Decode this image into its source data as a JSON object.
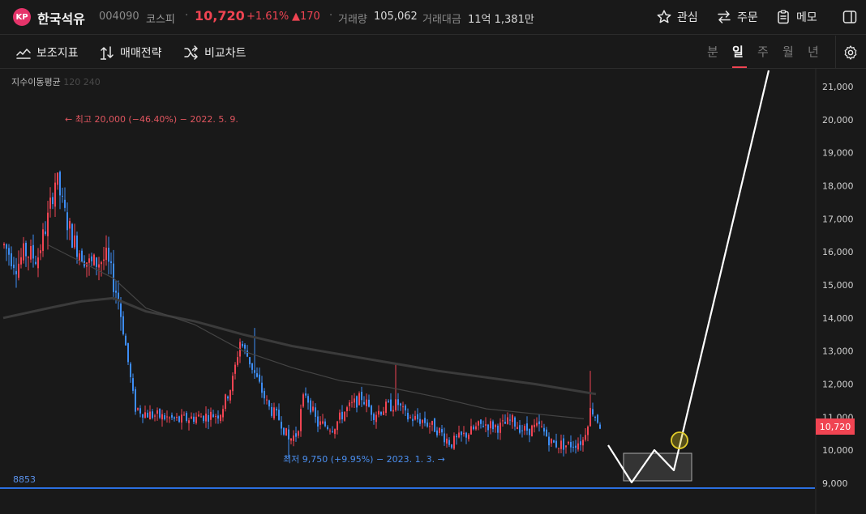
{
  "header": {
    "logo_text": "KP",
    "name": "한국석유",
    "code": "004090",
    "market": "코스피",
    "price": "10,720",
    "change_pct": "+1.61%",
    "change_amt": "▲170",
    "volume_label": "거래량",
    "volume_value": "105,062",
    "amount_label": "거래대금",
    "amount_value": "11억 1,381만",
    "favorite_label": "관심",
    "order_label": "주문",
    "memo_label": "메모"
  },
  "toolbar": {
    "indicator_label": "보조지표",
    "strategy_label": "매매전략",
    "compare_label": "비교차트",
    "periods": [
      "분",
      "일",
      "주",
      "월",
      "년"
    ],
    "active_period": "일"
  },
  "chart": {
    "ma_label": "지수이동평균",
    "ma_periods": "120 240",
    "high_annotation": "← 최고 20,000 (−46.40%) − 2022. 5. 9.",
    "low_annotation": "최저 9,750 (+9.95%) − 2023. 1. 3. →",
    "support_label": "8853",
    "current_price_tag": "10,720",
    "colors": {
      "up": "#f04452",
      "down": "#3d8df5",
      "support": "#2b6fe0"
    }
  },
  "chart_data": {
    "type": "candlestick",
    "y_ticks": [
      "21,000",
      "20,000",
      "19,000",
      "18,000",
      "17,000",
      "16,000",
      "15,000",
      "14,000",
      "13,000",
      "12,000",
      "11,000",
      "10,000",
      "9,000"
    ],
    "y_tick_values": [
      21000,
      20000,
      19000,
      18000,
      17000,
      16000,
      15000,
      14000,
      13000,
      12000,
      11000,
      10000,
      9000
    ],
    "ylim": [
      8500,
      21300
    ],
    "high": 20000,
    "low": 9750,
    "last": 10720,
    "support": 8853
  }
}
